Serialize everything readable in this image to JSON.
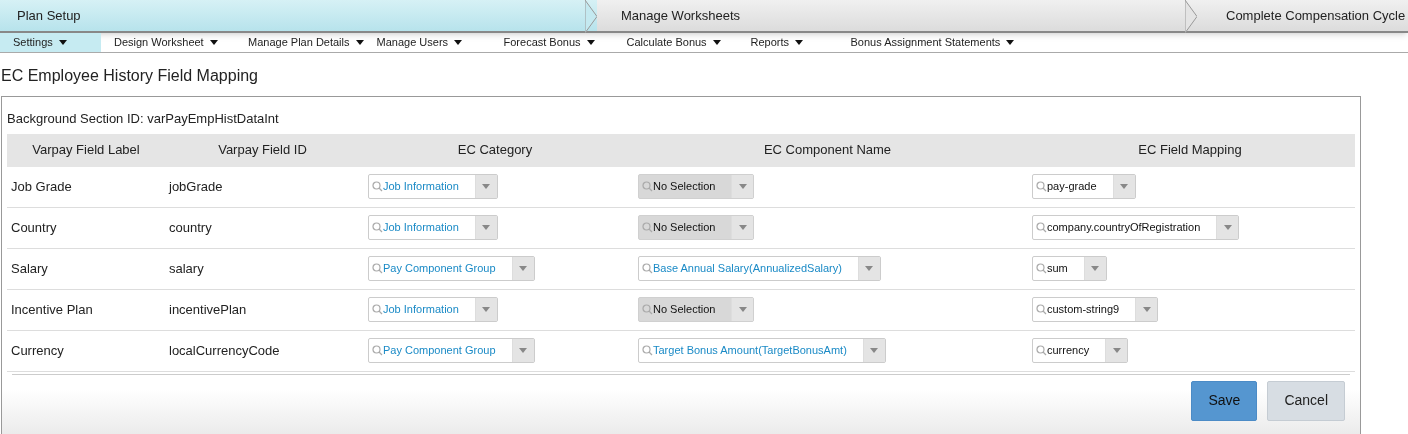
{
  "steps": [
    {
      "label": "Plan Setup",
      "selected": true
    },
    {
      "label": "Manage Worksheets",
      "selected": false
    },
    {
      "label": "Complete Compensation Cycle",
      "selected": false
    }
  ],
  "menu": [
    {
      "label": "Settings",
      "selected": true
    },
    {
      "label": "Design Worksheet",
      "selected": false
    },
    {
      "label": "Manage Plan Details",
      "selected": false
    },
    {
      "label": "Manage Users",
      "selected": false
    },
    {
      "label": "Forecast Bonus",
      "selected": false
    },
    {
      "label": "Calculate Bonus",
      "selected": false
    },
    {
      "label": "Reports",
      "selected": false
    },
    {
      "label": "Bonus Assignment Statements",
      "selected": false
    }
  ],
  "page_title": "EC Employee History Field Mapping",
  "section_id": "Background Section ID: varPayEmpHistDataInt",
  "table": {
    "columns": [
      "Varpay Field Label",
      "Varpay Field ID",
      "EC Category",
      "EC Component Name",
      "EC Field Mapping"
    ],
    "rows": [
      {
        "label": "Job Grade",
        "id": "jobGrade",
        "category": {
          "value": "Job Information",
          "disabled": false
        },
        "component": {
          "value": "No Selection",
          "disabled": true
        },
        "mapping": {
          "value": "pay-grade",
          "disabled": false
        }
      },
      {
        "label": "Country",
        "id": "country",
        "category": {
          "value": "Job Information",
          "disabled": false
        },
        "component": {
          "value": "No Selection",
          "disabled": true
        },
        "mapping": {
          "value": "company.countryOfRegistration",
          "disabled": false
        }
      },
      {
        "label": "Salary",
        "id": "salary",
        "category": {
          "value": "Pay Component Group",
          "disabled": false
        },
        "component": {
          "value": "Base Annual Salary(AnnualizedSalary)",
          "disabled": false
        },
        "mapping": {
          "value": "sum",
          "disabled": false
        }
      },
      {
        "label": "Incentive Plan",
        "id": "incentivePlan",
        "category": {
          "value": "Job Information",
          "disabled": false
        },
        "component": {
          "value": "No Selection",
          "disabled": true
        },
        "mapping": {
          "value": "custom-string9",
          "disabled": false
        }
      },
      {
        "label": "Currency",
        "id": "localCurrencyCode",
        "category": {
          "value": "Pay Component Group",
          "disabled": false
        },
        "component": {
          "value": "Target Bonus Amount(TargetBonusAmt)",
          "disabled": false
        },
        "mapping": {
          "value": "currency",
          "disabled": false
        }
      }
    ]
  },
  "buttons": [
    {
      "label": "Save",
      "kind": "primary"
    },
    {
      "label": "Cancel",
      "kind": "secondary"
    }
  ]
}
